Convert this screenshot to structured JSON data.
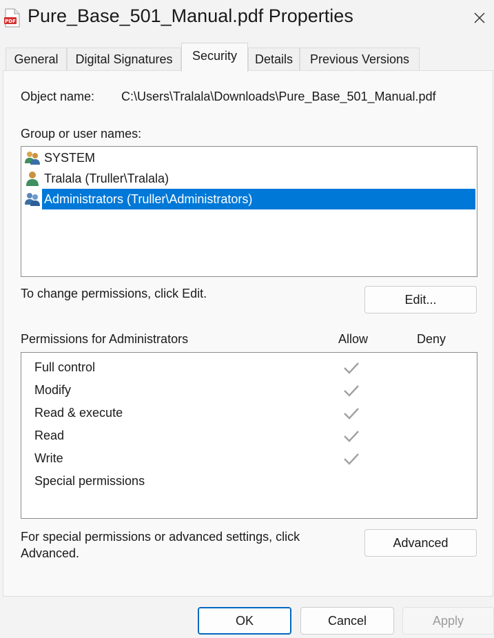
{
  "window": {
    "title": "Pure_Base_501_Manual.pdf Properties",
    "app_icon": "pdf-file-icon",
    "app_icon_text": "PDF",
    "close_icon": "close-icon"
  },
  "tabs": [
    {
      "label": "General",
      "active": false
    },
    {
      "label": "Digital Signatures",
      "active": false
    },
    {
      "label": "Security",
      "active": true
    },
    {
      "label": "Details",
      "active": false
    },
    {
      "label": "Previous Versions",
      "active": false
    }
  ],
  "security": {
    "object_name_label": "Object name:",
    "object_name_value": "C:\\Users\\Tralala\\Downloads\\Pure_Base_501_Manual.pdf",
    "group_label": "Group or user names:",
    "principals": [
      {
        "name": "SYSTEM",
        "icon": "user-group-icon",
        "selected": false
      },
      {
        "name": "Tralala (Truller\\Tralala)",
        "icon": "user-icon",
        "selected": false
      },
      {
        "name": "Administrators (Truller\\Administrators)",
        "icon": "user-group-icon",
        "selected": true
      }
    ],
    "change_hint": "To change permissions, click Edit.",
    "edit_button": "Edit...",
    "permissions_label": "Permissions for Administrators",
    "allow_header": "Allow",
    "deny_header": "Deny",
    "permissions": [
      {
        "name": "Full control",
        "allow": true,
        "deny": false
      },
      {
        "name": "Modify",
        "allow": true,
        "deny": false
      },
      {
        "name": "Read & execute",
        "allow": true,
        "deny": false
      },
      {
        "name": "Read",
        "allow": true,
        "deny": false
      },
      {
        "name": "Write",
        "allow": true,
        "deny": false
      },
      {
        "name": "Special permissions",
        "allow": false,
        "deny": false
      }
    ],
    "advanced_hint_line1": "For special permissions or advanced settings, click",
    "advanced_hint_line2": "Advanced.",
    "advanced_button": "Advanced"
  },
  "footer": {
    "ok": "OK",
    "cancel": "Cancel",
    "apply": "Apply",
    "apply_enabled": false
  },
  "colors": {
    "selection": "#0078d7",
    "check_inherited": "#a0a0a0",
    "primary_border": "#0067c0"
  }
}
